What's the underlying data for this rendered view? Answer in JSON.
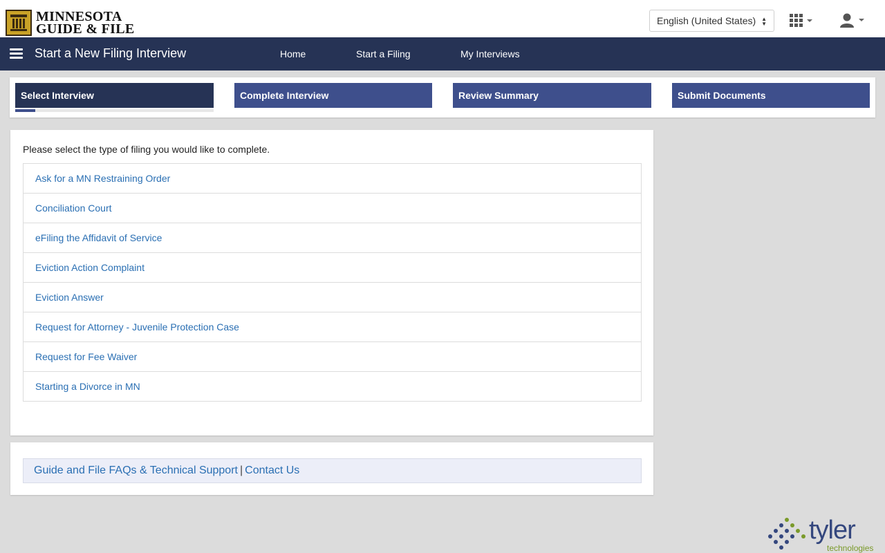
{
  "header": {
    "logo_line1": "MINNESOTA",
    "logo_line2": "GUIDE & FILE",
    "language_value": "English (United States)",
    "apps_icon": "grid-icon",
    "user_icon": "user-icon"
  },
  "navbar": {
    "title": "Start a New Filing Interview",
    "links": [
      "Home",
      "Start a Filing",
      "My Interviews"
    ]
  },
  "stepper": {
    "steps": [
      "Select Interview",
      "Complete Interview",
      "Review Summary",
      "Submit Documents"
    ],
    "active_index": 0
  },
  "main": {
    "prompt": "Please select the type of filing you would like to complete.",
    "filings": [
      "Ask for a MN Restraining Order",
      "Conciliation Court",
      "eFiling the Affidavit of Service",
      "Eviction Action Complaint",
      "Eviction Answer",
      "Request for Attorney - Juvenile Protection Case",
      "Request for Fee Waiver",
      "Starting a Divorce in MN"
    ]
  },
  "footer": {
    "faq_link": "Guide and File FAQs & Technical Support",
    "separator": "|",
    "contact_link": "Contact Us"
  },
  "branding": {
    "vendor_name": "tyler",
    "vendor_sub": "technologies"
  },
  "colors": {
    "navbar": "#263355",
    "step": "#3e4f8c",
    "link": "#2a6fb3",
    "background": "#dcdcdc"
  }
}
